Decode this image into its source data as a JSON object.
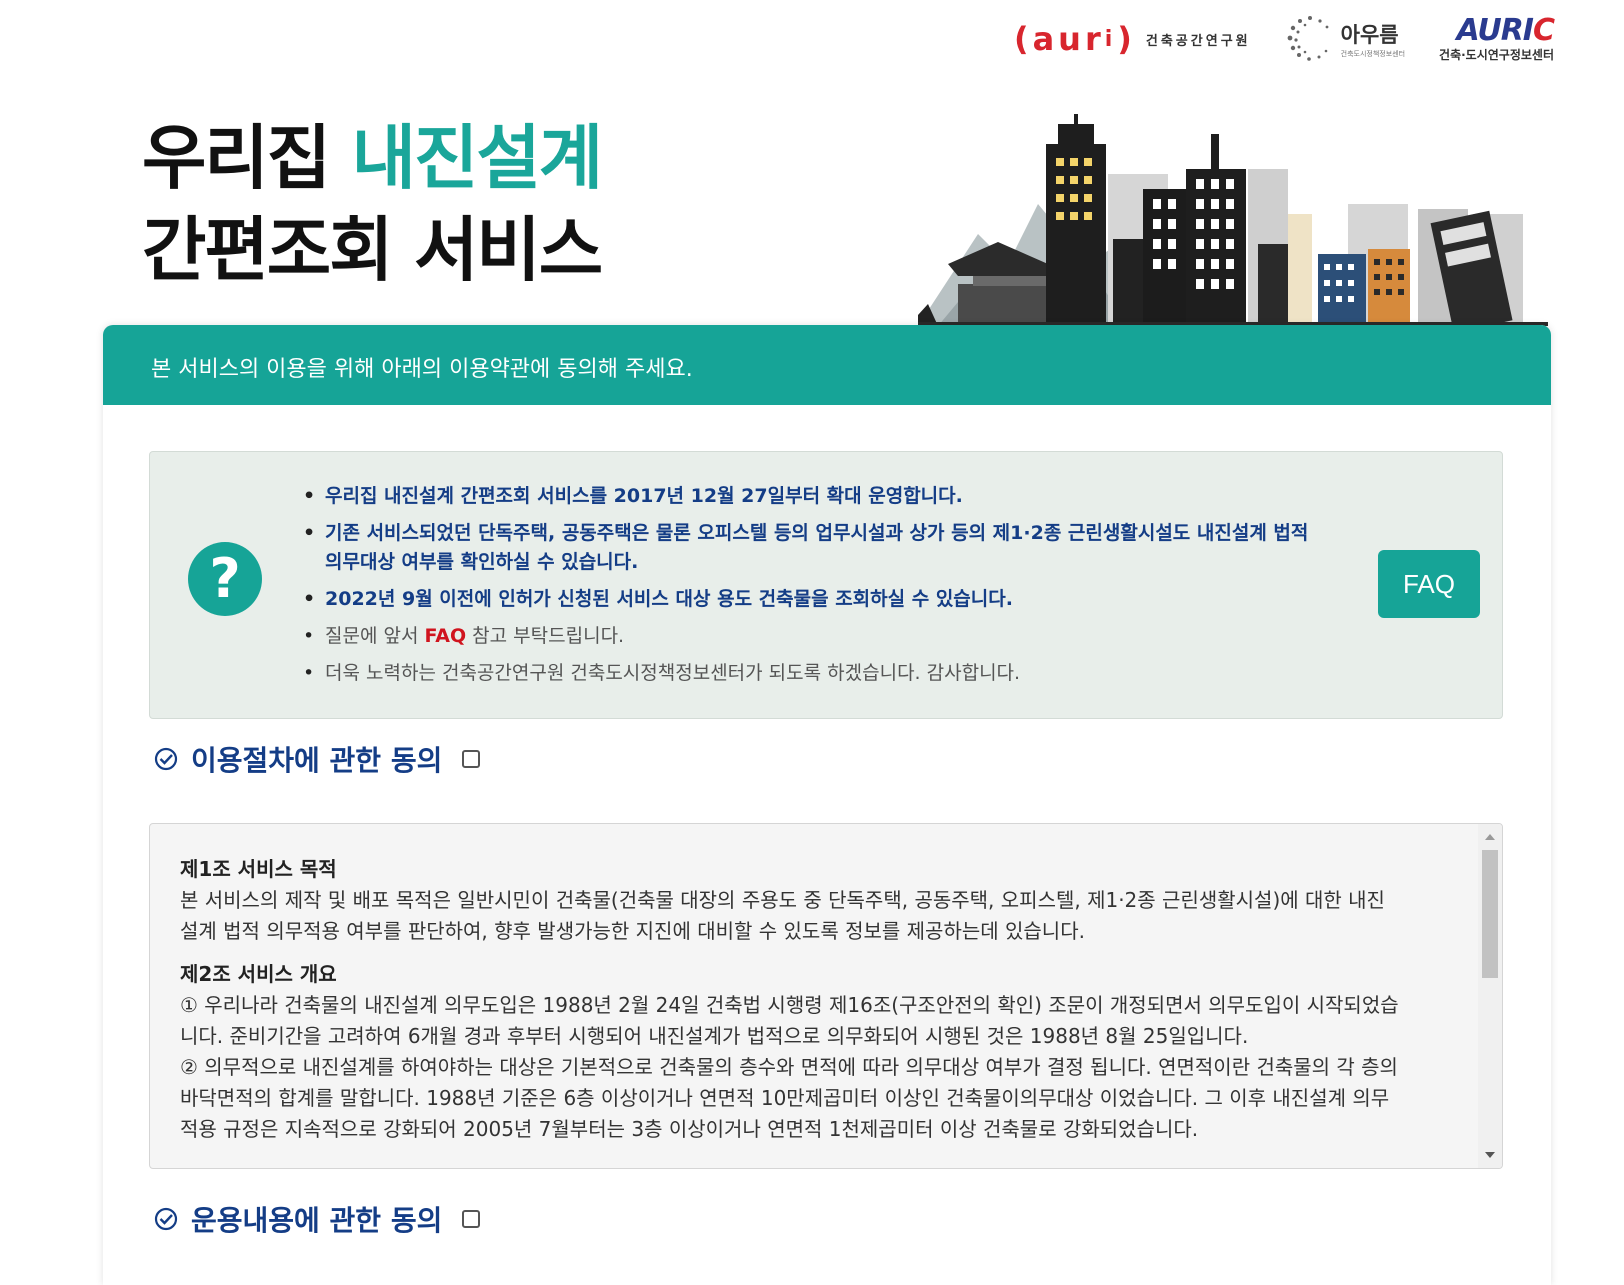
{
  "header": {
    "logos": {
      "aurai_mark": "(aur",
      "aurai_mark_i": "i",
      "aurai_mark_close": ")",
      "aurai_sub": "건축공간연구원",
      "aurum_big": "아우름",
      "aurum_tiny": "건축도시정책정보센터",
      "auric_big_a": "AURI",
      "auric_big_c": "C",
      "auric_sub": "건축·도시연구정보센터"
    },
    "title_line1_plain": "우리집 ",
    "title_line1_accent": "내진설계",
    "title_line2": "간편조회 서비스"
  },
  "card": {
    "head_text": "본 서비스의 이용을 위해 아래의 이용약관에 동의해 주세요.",
    "notice": {
      "items": [
        "우리집 내진설계 간편조회 서비스를 2017년 12월 27일부터 확대 운영합니다.",
        "기존 서비스되었던 단독주택, 공동주택은 물론 오피스텔 등의 업무시설과 상가 등의 제1·2종 근린생활시설도 내진설계 법적 의무대상 여부를 확인하실 수 있습니다.",
        "2022년 9월 이전에 인허가 신청된 서비스 대상 용도 건축물을 조회하실 수 있습니다.",
        "더욱 노력하는 건축공간연구원 건축도시정책정보센터가 되도록 하겠습니다. 감사합니다."
      ],
      "faq_note_pre": "질문에 앞서 ",
      "faq_note_link": "FAQ",
      "faq_note_post": " 참고 부탁드립니다.",
      "faq_button": "FAQ"
    },
    "sections": {
      "procedure_label": "이용절차에 관한 동의",
      "operation_label": "운용내용에 관한 동의"
    },
    "terms": {
      "art1_title": "제1조 서비스 목적",
      "art1_body": "본 서비스의 제작 및 배포 목적은 일반시민이 건축물(건축물 대장의 주용도 중 단독주택, 공동주택, 오피스텔, 제1·2종 근린생활시설)에 대한 내진설계 법적 의무적용 여부를 판단하여, 향후 발생가능한 지진에 대비할 수 있도록 정보를 제공하는데 있습니다.",
      "art2_title": "제2조 서비스 개요",
      "art2_p1": "① 우리나라 건축물의 내진설계 의무도입은 1988년 2월 24일 건축법 시행령 제16조(구조안전의 확인) 조문이 개정되면서 의무도입이 시작되었습니다. 준비기간을 고려하여 6개월 경과 후부터 시행되어 내진설계가 법적으로 의무화되어 시행된 것은 1988년 8월 25일입니다.",
      "art2_p2": "② 의무적으로 내진설계를 하여야하는 대상은 기본적으로 건축물의 층수와 면적에 따라 의무대상 여부가 결정 됩니다. 연면적이란 건축물의 각 층의 바닥면적의 합계를 말합니다. 1988년 기준은 6층 이상이거나 연면적 10만제곱미터 이상인 건축물이의무대상 이었습니다. 그 이후 내진설계 의무적용 규정은 지속적으로 강화되어 2005년 7월부터는 3층 이상이거나 연면적 1천제곱미터 이상 건축물로 강화되었습니다."
    }
  },
  "colors": {
    "accent": "#16a497",
    "navy": "#143d86",
    "red": "#d0141e"
  }
}
